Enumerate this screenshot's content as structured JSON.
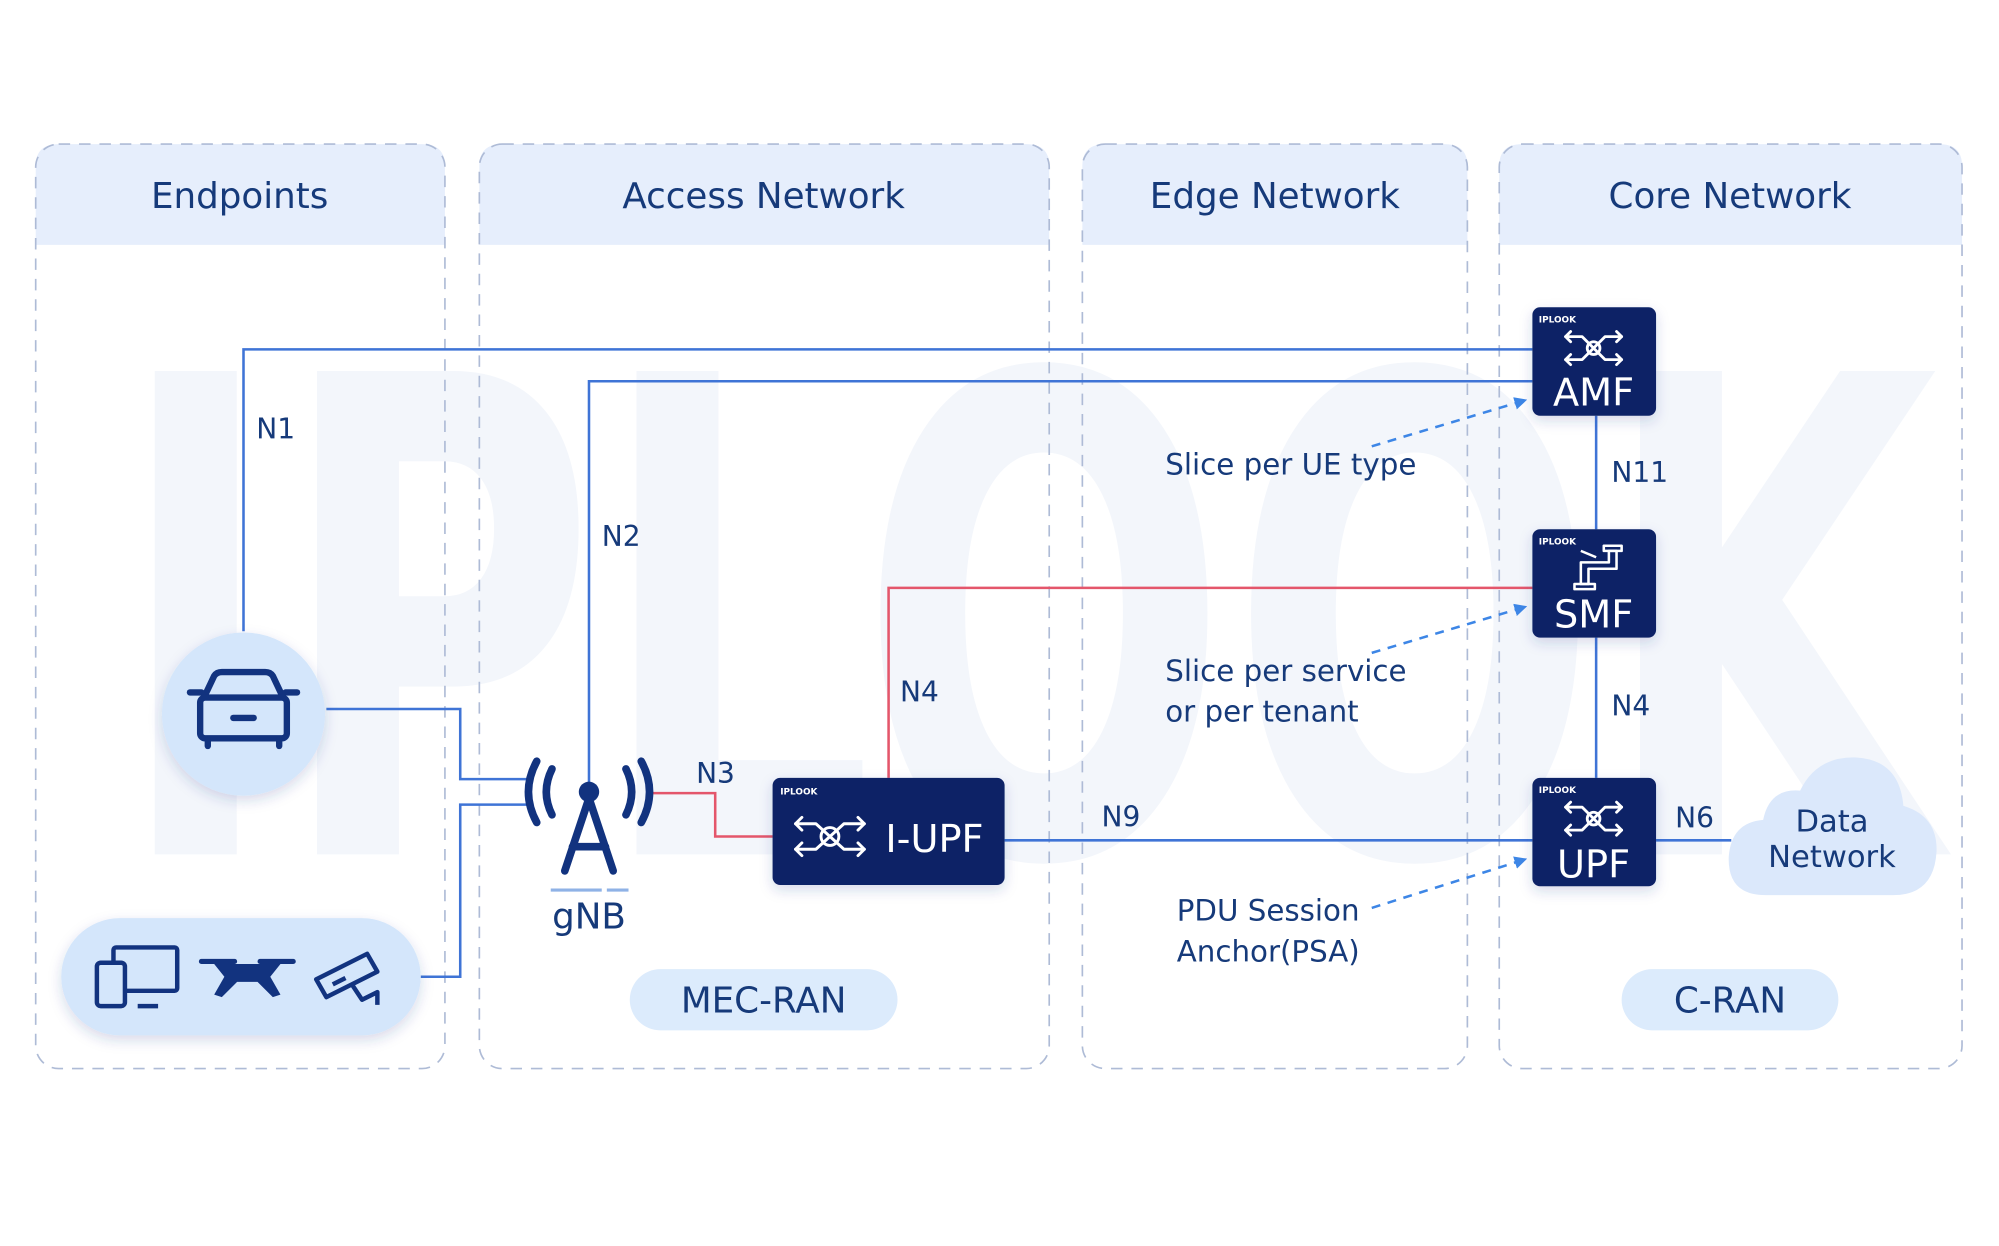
{
  "diagram": {
    "watermark": "IPLOOK",
    "columns": [
      {
        "id": "endpoints",
        "title": "Endpoints"
      },
      {
        "id": "access",
        "title": "Access Network"
      },
      {
        "id": "edge",
        "title": "Edge Network"
      },
      {
        "id": "core",
        "title": "Core Network"
      }
    ],
    "badges": {
      "mec_ran": "MEC-RAN",
      "c_ran": "C-RAN"
    },
    "nodes": {
      "car": {
        "icon": "car-icon"
      },
      "devices": {
        "icons": [
          "devices-icon",
          "drone-icon",
          "cctv-camera-icon"
        ]
      },
      "gnb": {
        "label": "gNB",
        "icon": "antenna-tower-icon"
      },
      "iupf": {
        "label": "I-UPF",
        "brand": "IPLOOK",
        "icon": "routing-user-icon"
      },
      "amf": {
        "label": "AMF",
        "brand": "IPLOOK",
        "icon": "routing-gear-icon"
      },
      "smf": {
        "label": "SMF",
        "brand": "IPLOOK",
        "icon": "pipe-wrench-icon"
      },
      "upf": {
        "label": "UPF",
        "brand": "IPLOOK",
        "icon": "routing-user-icon"
      },
      "data_network": {
        "line1": "Data",
        "line2": "Network",
        "icon": "cloud-icon"
      }
    },
    "interfaces": {
      "n1": "N1",
      "n2": "N2",
      "n3": "N3",
      "n4_edge": "N4",
      "n4_core": "N4",
      "n9": "N9",
      "n11": "N11",
      "n6": "N6"
    },
    "annotations": {
      "slice_ue": "Slice per UE type",
      "slice_service_1": "Slice per service",
      "slice_service_2": "or per tenant",
      "psa_1": "PDU Session",
      "psa_2": "Anchor(PSA)"
    },
    "colors": {
      "control_line": "#3f74d6",
      "user_line": "#e4566b",
      "nf_box": "#0c2466",
      "text": "#163a7a",
      "header_bg": "#e6eefc",
      "bubble": "#d4e6fb",
      "arrow": "#3d86e6"
    }
  }
}
